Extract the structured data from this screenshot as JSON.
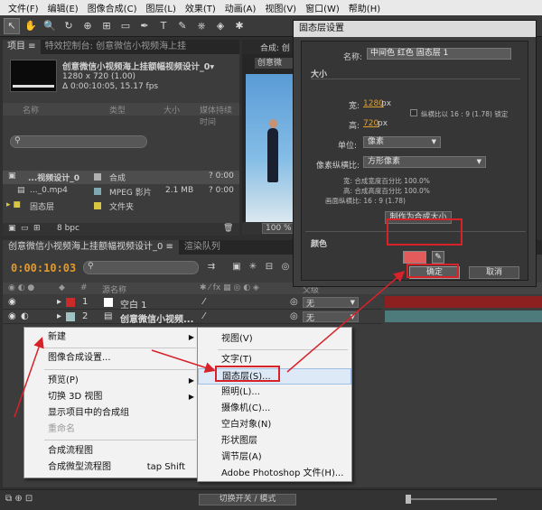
{
  "menubar": [
    "文件(F)",
    "编辑(E)",
    "图像合成(C)",
    "图层(L)",
    "效果(T)",
    "动画(A)",
    "视图(V)",
    "窗口(W)",
    "帮助(H)"
  ],
  "toolbar": {
    "icons": [
      "selection-tool-icon",
      "hand-tool-icon",
      "zoom-tool-icon",
      "rotate-tool-icon",
      "camera-orbit-icon",
      "pan-behind-icon",
      "rectangle-tool-icon",
      "pen-tool-icon",
      "text-tool-icon",
      "brush-tool-icon",
      "clone-stamp-icon",
      "eraser-tool-icon",
      "puppet-pin-icon"
    ],
    "glyphs": [
      "↖",
      "✋",
      "🔍",
      "↻",
      "⊕",
      "⊞",
      "▭",
      "✒",
      "T",
      "✎",
      "⎈",
      "◈",
      "✱"
    ]
  },
  "project": {
    "tabs": [
      "项目 ≡",
      "特效控制台: 创意微信小视频海上挂"
    ],
    "comp_name": "创意微信小视频海上挂额幅视频设计_0▾",
    "comp_size": "1280 x 720 (1.00)",
    "comp_duration": "Δ 0:00:10:05, 15.17 fps",
    "search_placeholder": "",
    "columns": {
      "name": "名称",
      "type": "类型",
      "size": "大小",
      "duration": "媒体持续时间"
    },
    "items": [
      {
        "name": "...视频设计_0",
        "type": "合成",
        "size": "",
        "duration": "? 0:00",
        "color": "#b0b0b0",
        "icon": "▣"
      },
      {
        "name": "..._0.mp4",
        "type": "MPEG 影片",
        "size": "2.1 MB",
        "duration": "? 0:00",
        "color": "#7fa9b0",
        "icon": "▤"
      },
      {
        "name": "固态层",
        "type": "文件夹",
        "size": "",
        "duration": "",
        "color": "#d8c640",
        "icon": "▸ ■"
      }
    ],
    "footer": {
      "bpc": "8 bpc"
    }
  },
  "composition": {
    "tab": "合成: 创意",
    "subtab": "创意微",
    "zoom": "100 %"
  },
  "timeline": {
    "tabs": [
      "创意微信小视频海上挂额幅视频设计_0 ≡",
      "渲染队列"
    ],
    "timecode": "0:00:10:03",
    "columns": {
      "num": "#",
      "source": "源名称",
      "parent": "父级"
    },
    "layers": [
      {
        "num": "1",
        "name": "空白 1",
        "parent": "无",
        "color": "#cc2a2a",
        "bar": "#8c2020"
      },
      {
        "num": "2",
        "name": "创意微信小视频...",
        "parent": "无",
        "color": "#9fc3c3",
        "bar": "#4d7a7a"
      }
    ]
  },
  "statusbar": {
    "toggle_label": "切换开关 / 模式"
  },
  "context_menu": {
    "items": [
      {
        "label": "新建",
        "submenu": true
      },
      {
        "label": "图像合成设置..."
      },
      {
        "label": "预览(P)",
        "submenu": true
      },
      {
        "label": "切换 3D 视图",
        "submenu": true
      },
      {
        "label": "显示项目中的合成组"
      },
      {
        "label": "重命名",
        "disabled": true
      },
      {
        "label": "合成流程图"
      },
      {
        "label": "合成微型流程图",
        "shortcut": "tap Shift"
      }
    ]
  },
  "submenu": {
    "items": [
      "视图(V)",
      "文字(T)",
      "固态层(S)...",
      "照明(L)...",
      "摄像机(C)...",
      "空白对象(N)",
      "形状图层",
      "调节层(A)",
      "Adobe Photoshop 文件(H)..."
    ]
  },
  "dialog": {
    "title": "固态层设置",
    "name_label": "名称:",
    "name_value": "中间色 红色 固态层 1",
    "size_section": "大小",
    "width_label": "宽:",
    "width_value": "1280",
    "height_label": "高:",
    "height_value": "720",
    "px": "px",
    "lock_label": "纵横比以 16 : 9 (1.78) 锁定",
    "units_label": "单位:",
    "units_value": "像素",
    "pixel_aspect_label": "像素纵横比:",
    "pixel_aspect_value": "方形像素",
    "info_w": "宽: 合成宽度百分比 100.0%",
    "info_h": "高: 合成高度百分比 100.0%",
    "info_ratio": "画面纵横比: 16 : 9 (1.78)",
    "make_comp_size": "制作为合成大小",
    "color_section": "颜色",
    "swatch_color": "#e35b5b",
    "ok": "确定",
    "cancel": "取消"
  },
  "annotation_color": "#d8222a"
}
